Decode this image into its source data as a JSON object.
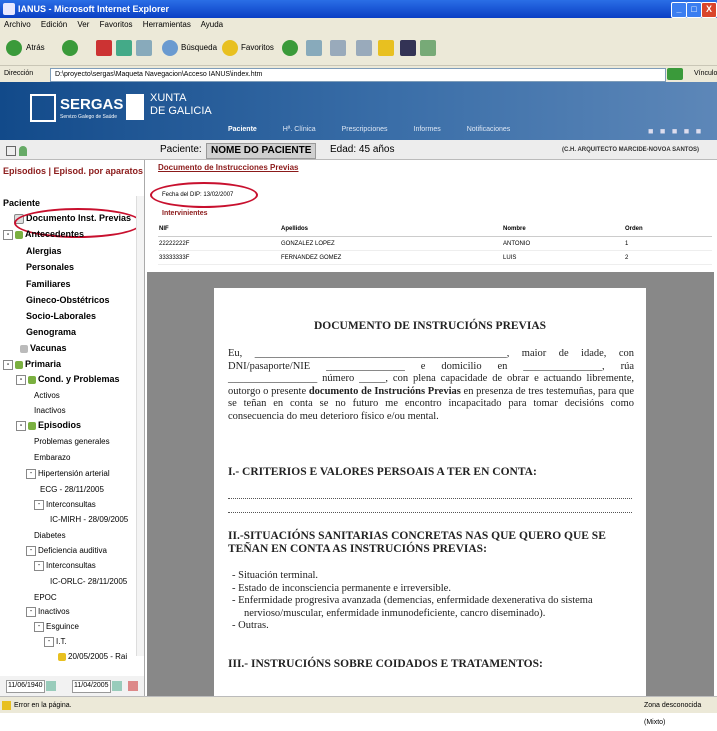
{
  "window": {
    "title": "IANUS - Microsoft Internet Explorer",
    "controls": [
      "_",
      "□",
      "X"
    ]
  },
  "menu": [
    "Archivo",
    "Edición",
    "Ver",
    "Favoritos",
    "Herramientas",
    "Ayuda"
  ],
  "toolbar": {
    "back": "Atrás",
    "search": "Búsqueda",
    "favorites": "Favoritos"
  },
  "address": {
    "label": "Dirección",
    "value": "D:\\proyecto\\sergas\\Maqueta Navegacion\\Acceso IANUS\\index.htm",
    "links": "Vínculos"
  },
  "banner": {
    "sergas": "SERGAS",
    "sergas_sub": "Servizo Galego de Saúde",
    "xunta_line1": "XUNTA",
    "xunta_line2": "DE GALICIA",
    "tabs": [
      "Paciente",
      "Hª. Clínica",
      "Prescripciones",
      "Informes",
      "Notificaciones"
    ]
  },
  "patient": {
    "label": "Paciente:",
    "name": "NOME DO PACIENTE",
    "age": "Edad:  45 años",
    "center": "(C.H. ARQUITECTO MARCIDE-NOVOA SANTOS)"
  },
  "left": {
    "tabs": "Episodios | Episod. por aparatos",
    "section": "Paciente",
    "items": {
      "doc_inst": "Documento Inst. Previas",
      "antecedentes": "Antecedentes",
      "alergias": "Alergias",
      "personales": "Personales",
      "familiares": "Familiares",
      "gineco": "Gineco-Obstétricos",
      "socio": "Socio-Laborales",
      "genograma": "Genograma",
      "vacunas": "Vacunas",
      "primaria": "Primaria",
      "cond": "Cond. y Problemas",
      "activos": "Activos",
      "inactivos": "Inactivos",
      "episodios": "Episodios",
      "problemas": "Problemas generales",
      "embarazo": "Embarazo",
      "hta": "Hipertensión arterial",
      "ecg": "ECG - 28/11/2005",
      "inter1": "Interconsultas",
      "ic_mirh": "IC-MIRH - 28/09/2005",
      "diabetes": "Diabetes",
      "deficiencia": "Deficiencia auditiva",
      "inter2": "Interconsultas",
      "ic_orlc": "IC-ORLC- 28/11/2005",
      "epoc": "EPOC",
      "inactivos2": "Inactivos",
      "esguince": "Esguince",
      "it": "I.T.",
      "it_date": "20/05/2005 - Rai"
    },
    "date_from": "11/06/1940",
    "date_to": "11/04/2005"
  },
  "main": {
    "doc_title": "Documento de Instrucciones Previas",
    "doc_date": "Fecha del DIP: 13/02/2007",
    "interv_label": "Intervinientes",
    "table": {
      "headers": [
        "NIF",
        "Apellidos",
        "Nombre",
        "Orden"
      ],
      "rows": [
        [
          "22222222F",
          "GONZALEZ LOPEZ",
          "ANTONIO",
          "1"
        ],
        [
          "33333333F",
          "FERNANDEZ GOMEZ",
          "LUIS",
          "2"
        ]
      ]
    }
  },
  "document": {
    "heading": "DOCUMENTO DE INSTRUCIÓNS PREVIAS",
    "p1_a": "Eu, ________________________________________________, maior de idade, con DNI/pasaporte/NIE _______________ e domicilio en _______________, rúa _________________ número _____, con plena capacidade de obrar e actuando libremente, outorgo o presente ",
    "p1_bold": "documento de Instrucións Previas",
    "p1_b": " en presenza de tres testemuñas, para que se teñan en conta se no futuro me encontro incapacitado para tomar decisións como consecuencia do meu deterioro físico e/ou mental.",
    "s1": "I.- CRITERIOS E VALORES PERSOAIS A TER EN CONTA:",
    "s2": "II.-SITUACIÓNS SANITARIAS CONCRETAS NAS QUE QUERO QUE SE TEÑAN EN CONTA AS INSTRUCIÓNS PREVIAS:",
    "bullets": [
      "Situación terminal.",
      "Estado de inconsciencia permanente e irreversible.",
      "Enfermidade progresiva avanzada (demencias, enfermidade dexenerativa do sistema nervioso/muscular, enfermidade inmunodeficiente, cancro diseminado).",
      "Outras."
    ],
    "s3": "III.- INSTRUCIÓNS SOBRE COIDADOS E TRATAMENTOS:"
  },
  "status": {
    "left": "Error en la página.",
    "right": "Zona desconocida (Mixto)"
  }
}
